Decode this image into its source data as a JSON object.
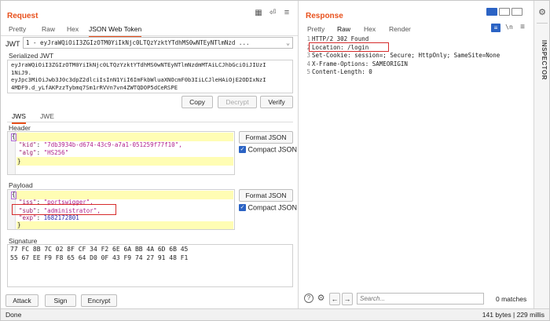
{
  "request": {
    "title": "Request",
    "tabs": [
      "Pretty",
      "Raw",
      "Hex",
      "JSON Web Token"
    ],
    "jwt_label": "JWT",
    "jwt_select_value": "1 - eyJraWQiOiI3ZGIzOTM0YiIkNjc0LTQzYzktYTdhMS0wNTEyNTlmNzd ...",
    "serialized_label": "Serialized JWT",
    "serialized_lines": [
      "eyJraWQiOiI3ZGIzOTM0YiIkNjc0LTQzYzktYTdhMS0wNTEyNTlmNzdmMTAiLCJhbGciOiJIUzI",
      "1NiJ9.",
      "eyJpc3MiOiJwb3J0c3dpZ2dlciIsInN1YiI6ImFkbWluaXNOcmF0b3IiLCJleHAiOjE2ODIxNzI",
      "4MDF9.d_yLfAKPzzTybmq7Sm1rRVVn7vn4ZWTQDOP5dCeRSPE"
    ],
    "copy_label": "Copy",
    "decrypt_label": "Decrypt",
    "verify_label": "Verify",
    "subtabs": [
      "JWS",
      "JWE"
    ],
    "header_label": "Header",
    "header_lines": [
      "{",
      "  \"kid\": \"7db3934b-d674-43c9-a7a1-051259f77f10\",",
      "  \"alg\": \"HS256\"",
      "}"
    ],
    "header_kid_key": "\"kid\"",
    "header_kid_val": "\"7db3934b-d674-43c9-a7a1-051259f77f10\",",
    "header_alg_key": "\"alg\"",
    "header_alg_val": "\"HS256\"",
    "format_json_label": "Format JSON",
    "compact_json_label": "Compact JSON",
    "payload_label": "Payload",
    "payload_iss_key": "\"iss\"",
    "payload_iss_val": "\"portswigger\",",
    "payload_sub_key": "\"sub\"",
    "payload_sub_val": "\"administrator\",",
    "payload_exp_key": "\"exp\"",
    "payload_exp_val": "1682172801",
    "signature_label": "Signature",
    "signature_lines": [
      "77 FC 8B 7C 02 8F CF 34 F2 6E 6A BB 4A 6D 6B 45",
      "55 67 EE F9 F8 65 64 D0 0F 43 F9 74 27 91 48 F1"
    ],
    "attack_label": "Attack",
    "sign_label": "Sign",
    "encrypt_label": "Encrypt"
  },
  "response": {
    "title": "Response",
    "tabs": [
      "Pretty",
      "Raw",
      "Hex",
      "Render"
    ],
    "lines": [
      "HTTP/2 302 Found",
      "Location: /login",
      "Set-Cookie: session=; Secure; HttpOnly; SameSite=None",
      "X-Frame-Options: SAMEORIGIN",
      "Content-Length: 0"
    ],
    "line_numbers": [
      "1",
      "2",
      "3",
      "4",
      "5"
    ],
    "search_placeholder": "Search...",
    "matches": "0 matches",
    "newline_toggle": "\\n"
  },
  "inspector_label": "INSPECTOR",
  "status": {
    "left": "Done",
    "right": "141 bytes | 229 millis"
  },
  "colors": {
    "accent": "#e8501c",
    "json_key": "#9c1c6b",
    "json_string": "#b0228c",
    "highlight": "#fffdb4",
    "red_box": "#d62b2b"
  }
}
